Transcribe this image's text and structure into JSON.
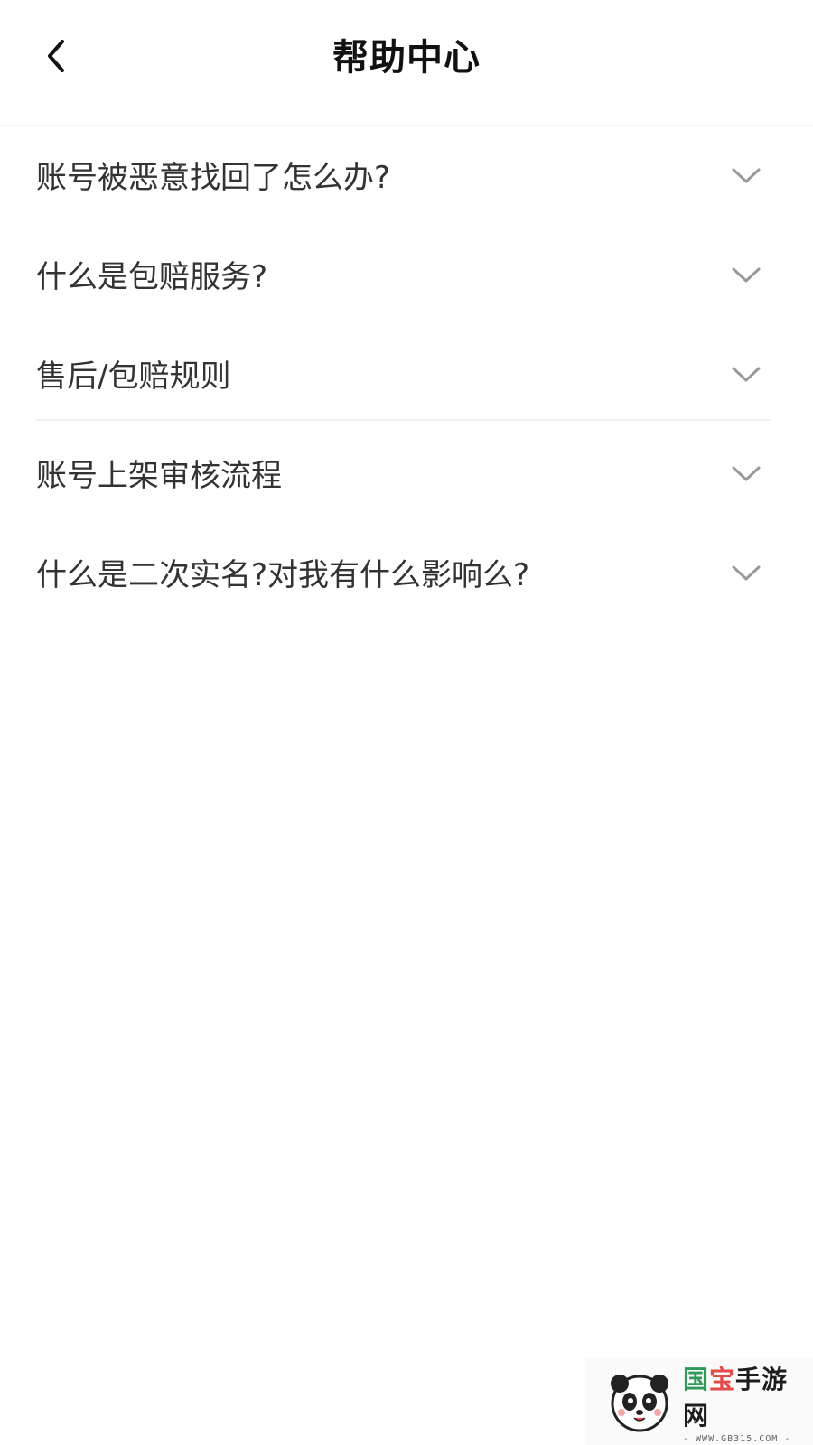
{
  "header": {
    "title": "帮助中心",
    "back_icon": "chevron-left-icon"
  },
  "faq": {
    "items": [
      {
        "question": "账号被恶意找回了怎么办?",
        "expand_icon": "chevron-down-icon"
      },
      {
        "question": "什么是包赔服务?",
        "expand_icon": "chevron-down-icon"
      },
      {
        "question": "售后/包赔规则",
        "expand_icon": "chevron-down-icon"
      },
      {
        "question": "账号上架审核流程",
        "expand_icon": "chevron-down-icon"
      },
      {
        "question": "什么是二次实名?对我有什么影响么?",
        "expand_icon": "chevron-down-icon"
      }
    ]
  },
  "watermark": {
    "brand_part1": "国",
    "brand_part2": "宝",
    "brand_part3": "手游网",
    "url": "- WWW.GB315.COM -"
  },
  "colors": {
    "text_primary": "#333333",
    "title": "#111111",
    "chevron": "#999999",
    "divider": "#f1f1f1"
  }
}
